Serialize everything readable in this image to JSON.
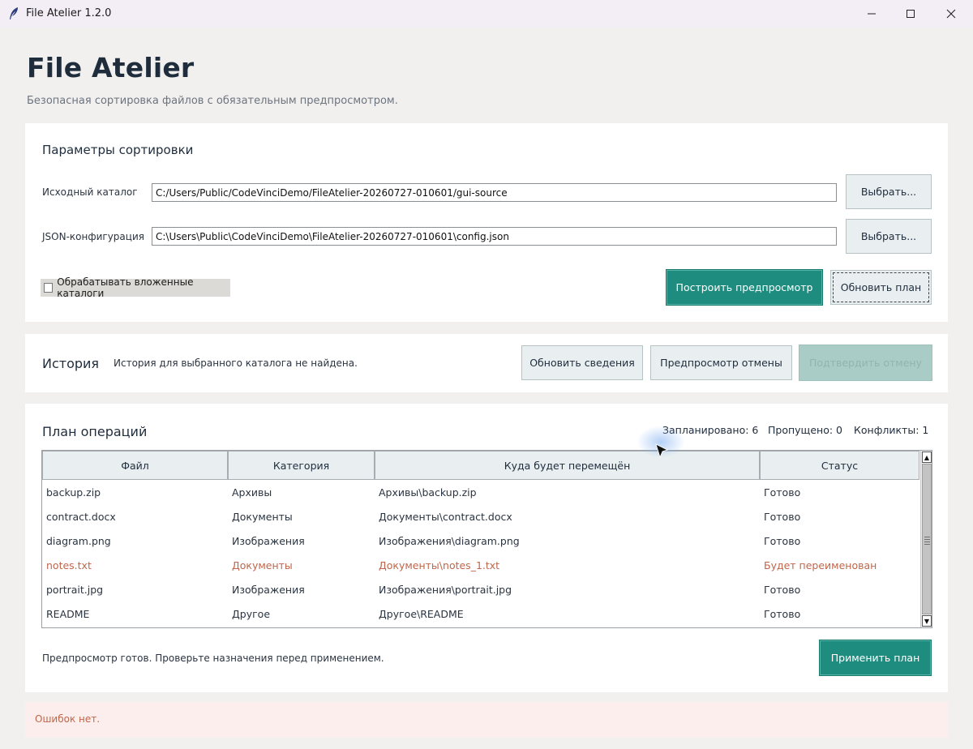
{
  "window": {
    "title": "File Atelier 1.2.0",
    "icons": {
      "app": "feather-icon",
      "minimize": "minimize-icon",
      "maximize": "maximize-icon",
      "close": "close-icon"
    }
  },
  "header": {
    "title": "File Atelier",
    "subtitle": "Безопасная сортировка файлов с обязательным предпросмотром."
  },
  "params": {
    "title": "Параметры сортировки",
    "source_label": "Исходный каталог",
    "source_value": "C:/Users/Public/CodeVinciDemo/FileAtelier-20260727-010601/gui-source",
    "config_label": "JSON-конфигурация",
    "config_value": "C:\\Users\\Public\\CodeVinciDemo\\FileAtelier-20260727-010601\\config.json",
    "browse_label": "Выбрать...",
    "recursive_label": "Обрабатывать вложенные каталоги",
    "recursive_checked": false,
    "build_preview_label": "Построить предпросмотр",
    "refresh_plan_label": "Обновить план"
  },
  "history": {
    "title": "История",
    "message": "История для выбранного каталога не найдена.",
    "refresh_label": "Обновить сведения",
    "undo_preview_label": "Предпросмотр отмены",
    "confirm_undo_label": "Подтвердить отмену"
  },
  "plan": {
    "title": "План операций",
    "planned": "Запланировано: 6",
    "skipped": "Пропущено: 0",
    "conflicts": "Конфликты: 1",
    "columns": [
      "Файл",
      "Категория",
      "Куда будет перемещён",
      "Статус"
    ],
    "rows": [
      {
        "file": "backup.zip",
        "category": "Архивы",
        "dest": "Архивы\\backup.zip",
        "status": "Готово",
        "warn": false
      },
      {
        "file": "contract.docx",
        "category": "Документы",
        "dest": "Документы\\contract.docx",
        "status": "Готово",
        "warn": false
      },
      {
        "file": "diagram.png",
        "category": "Изображения",
        "dest": "Изображения\\diagram.png",
        "status": "Готово",
        "warn": false
      },
      {
        "file": "notes.txt",
        "category": "Документы",
        "dest": "Документы\\notes_1.txt",
        "status": "Будет переименован",
        "warn": true
      },
      {
        "file": "portrait.jpg",
        "category": "Изображения",
        "dest": "Изображения\\portrait.jpg",
        "status": "Готово",
        "warn": false
      },
      {
        "file": "README",
        "category": "Другое",
        "dest": "Другое\\README",
        "status": "Готово",
        "warn": false
      }
    ],
    "status_message": "Предпросмотр готов. Проверьте назначения перед применением.",
    "apply_label": "Применить план"
  },
  "errors": {
    "message": "Ошибок нет."
  },
  "colors": {
    "accent": "#1e8c7e",
    "warning": "#c0664b",
    "disabled": "#a9cdc6"
  }
}
